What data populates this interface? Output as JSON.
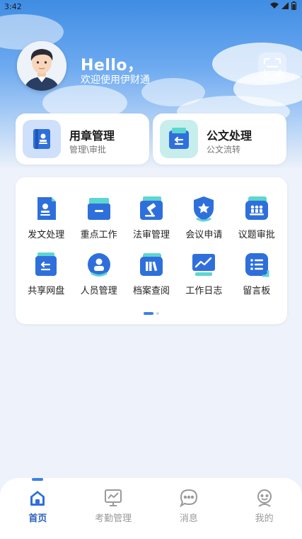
{
  "status": {
    "time": "3:42"
  },
  "header": {
    "greeting": "Hello，",
    "welcome": "欢迎使用伊财通"
  },
  "cards": [
    {
      "title": "用章管理",
      "subtitle": "管理\\审批",
      "icon": "seal-icon"
    },
    {
      "title": "公文处理",
      "subtitle": "公文流转",
      "icon": "document-exchange-icon"
    }
  ],
  "grid": [
    {
      "label": "发文处理",
      "icon": "document-send-icon"
    },
    {
      "label": "重点工作",
      "icon": "inbox-tray-icon"
    },
    {
      "label": "法审管理",
      "icon": "gavel-icon"
    },
    {
      "label": "会议申请",
      "icon": "shield-star-icon"
    },
    {
      "label": "议题审批",
      "icon": "meeting-people-icon"
    },
    {
      "label": "共享网盘",
      "icon": "shared-folder-icon"
    },
    {
      "label": "人员管理",
      "icon": "person-icon"
    },
    {
      "label": "档案查阅",
      "icon": "archive-books-icon"
    },
    {
      "label": "工作日志",
      "icon": "chart-monitor-icon"
    },
    {
      "label": "留言板",
      "icon": "message-list-icon"
    }
  ],
  "pagination": {
    "pages": 2,
    "active": 1
  },
  "tabs": [
    {
      "label": "首页",
      "icon": "home-icon",
      "active": true
    },
    {
      "label": "考勤管理",
      "icon": "attendance-monitor-icon",
      "active": false
    },
    {
      "label": "消息",
      "icon": "chat-bubble-icon",
      "active": false
    },
    {
      "label": "我的",
      "icon": "user-face-icon",
      "active": false
    }
  ],
  "colors": {
    "accent": "#3b82e6",
    "teal": "#5dd6d0",
    "icon_blue": "#2f6fdc"
  }
}
